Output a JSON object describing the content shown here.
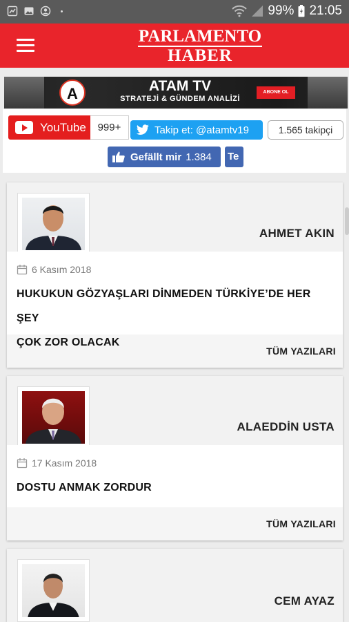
{
  "status_bar": {
    "battery": "99%",
    "time": "21:05"
  },
  "header": {
    "logo_top": "PARLAMENTO",
    "logo_bottom": "HABER"
  },
  "banner": {
    "title": "ATAM TV",
    "subtitle": "STRATEJİ & GÜNDEM ANALİZİ",
    "logo_letter": "A",
    "subscribe": "ABONE OL"
  },
  "social": {
    "youtube_label": "YouTube",
    "youtube_count": "999+",
    "twitter_label": "Takip et: @atamtv19",
    "twitter_count": "1.565 takipçi",
    "facebook_label": "Gefällt mir",
    "facebook_count": "1.384",
    "facebook_share": "Te"
  },
  "columns": [
    {
      "author": "AHMET AKIN",
      "date": "6 Kasım 2018",
      "title_lines": [
        "HUKUKUN GÖZYAŞLARI DİNMEDEN TÜRKİYE’DE HER ŞEY",
        "ÇOK ZOR OLACAK"
      ],
      "more": "TÜM YAZILARI"
    },
    {
      "author": "ALAEDDİN USTA",
      "date": "17 Kasım 2018",
      "title_lines": [
        "DOSTU ANMAK ZORDUR"
      ],
      "more": "TÜM YAZILARI"
    },
    {
      "author": "CEM AYAZ"
    }
  ],
  "colors": {
    "brand_red": "#e9242b",
    "youtube_red": "#e41e1e",
    "twitter_blue": "#1da1f2",
    "facebook_blue": "#4267b2"
  }
}
